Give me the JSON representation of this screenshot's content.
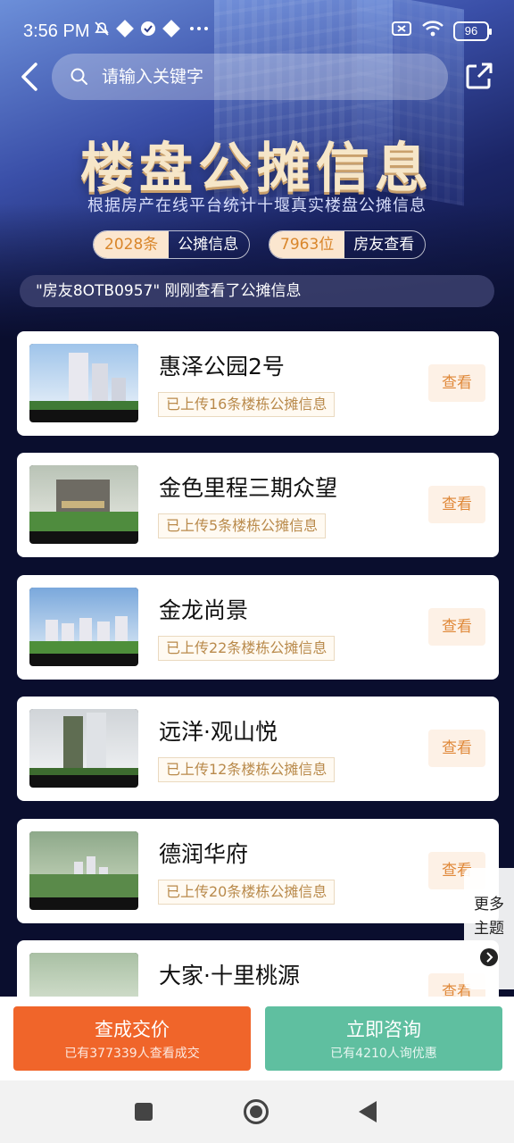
{
  "status_bar": {
    "time": "3:56 PM",
    "battery": "96",
    "left_icons": [
      "mute-icon",
      "app-icon",
      "check-badge-icon",
      "app-icon",
      "more-dots-icon"
    ],
    "right_icons": [
      "sim-off-icon",
      "wifi-icon",
      "battery-icon"
    ]
  },
  "header": {
    "search_placeholder": "请输入关键字",
    "back_icon": "back-arrow-icon",
    "share_icon": "share-icon"
  },
  "hero": {
    "title": "楼盘公摊信息",
    "subtitle": "根据房产在线平台统计十堰真实楼盘公摊信息",
    "stats": [
      {
        "value": "2028条",
        "label": "公摊信息"
      },
      {
        "value": "7963位",
        "label": "房友查看"
      }
    ],
    "ticker": "\"房友8OTB0957\" 刚刚查看了公摊信息"
  },
  "listings": [
    {
      "name": "惠泽公园2号",
      "tag": "已上传16条楼栋公摊信息",
      "button": "查看"
    },
    {
      "name": "金色里程三期众望",
      "tag": "已上传5条楼栋公摊信息",
      "button": "查看"
    },
    {
      "name": "金龙尚景",
      "tag": "已上传22条楼栋公摊信息",
      "button": "查看"
    },
    {
      "name": "远洋·观山悦",
      "tag": "已上传12条楼栋公摊信息",
      "button": "查看"
    },
    {
      "name": "德润华府",
      "tag": "已上传20条楼栋公摊信息",
      "button": "查看"
    },
    {
      "name": "大家·十里桃源",
      "tag": "",
      "button": "查看"
    }
  ],
  "side_float": {
    "label_line1": "更多",
    "label_line2": "主题"
  },
  "bottom_actions": {
    "left": {
      "main": "查成交价",
      "sub": "已有377339人查看成交"
    },
    "right": {
      "main": "立即咨询",
      "sub": "已有4210人询优惠"
    }
  },
  "colors": {
    "accent_orange": "#f0652a",
    "accent_green": "#5fbfa0",
    "tag_gold": "#b98a4b",
    "hero_title": "#f6e6c8"
  }
}
